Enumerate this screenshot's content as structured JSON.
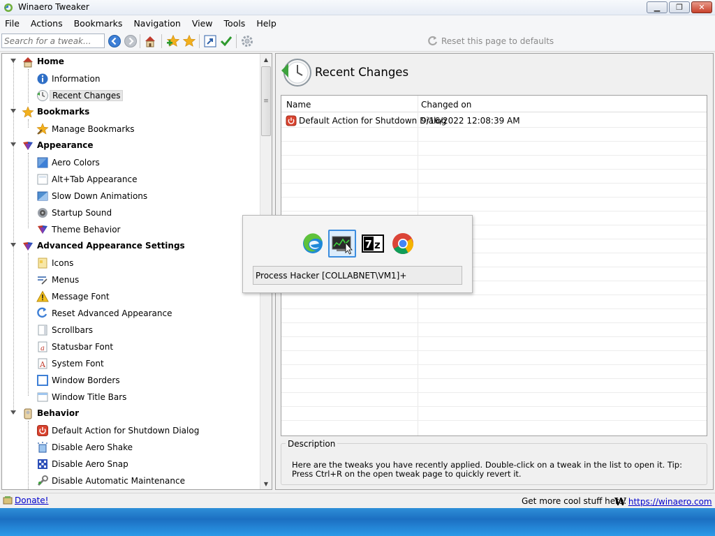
{
  "window": {
    "title": "Winaero Tweaker"
  },
  "menu": [
    "File",
    "Actions",
    "Bookmarks",
    "Navigation",
    "View",
    "Tools",
    "Help"
  ],
  "toolbar": {
    "search_placeholder": "Search for a tweak...",
    "reset_label": "Reset this page to defaults"
  },
  "tree": {
    "home": "Home",
    "information": "Information",
    "recent_changes": "Recent Changes",
    "bookmarks": "Bookmarks",
    "manage_bookmarks": "Manage Bookmarks",
    "appearance": "Appearance",
    "aero_colors": "Aero Colors",
    "alt_tab_appearance": "Alt+Tab Appearance",
    "slow_down_animations": "Slow Down Animations",
    "startup_sound": "Startup Sound",
    "theme_behavior": "Theme Behavior",
    "advanced_appearance": "Advanced Appearance Settings",
    "icons": "Icons",
    "menus": "Menus",
    "message_font": "Message Font",
    "reset_advanced_appearance": "Reset Advanced Appearance",
    "scrollbars": "Scrollbars",
    "statusbar_font": "Statusbar Font",
    "system_font": "System Font",
    "window_borders": "Window Borders",
    "window_title_bars": "Window Title Bars",
    "behavior": "Behavior",
    "default_action_shutdown": "Default Action for Shutdown Dialog",
    "disable_aero_shake": "Disable Aero Shake",
    "disable_aero_snap": "Disable Aero Snap",
    "disable_automatic_maintenance": "Disable Automatic Maintenance"
  },
  "page": {
    "title": "Recent Changes",
    "columns": {
      "name": "Name",
      "changed_on": "Changed on"
    },
    "rows": [
      {
        "name": "Default Action for Shutdown Dialog",
        "changed_on": "9/16/2022 12:08:39 AM"
      }
    ],
    "description_legend": "Description",
    "description_text": "Here are the tweaks you have recently applied. Double-click on a tweak in the list to open it. Tip: Press Ctrl+R on the open tweak page to quickly revert it."
  },
  "statusbar": {
    "donate": "Donate!",
    "more": "Get more cool stuff here:",
    "site_logo": "W",
    "site_url": "https://winaero.com"
  },
  "alttab": {
    "apps": [
      "edge-icon",
      "process-hacker-icon",
      "7zip-icon",
      "chrome-icon"
    ],
    "selected_index": 1,
    "caption": "Process Hacker [COLLABNET\\VM1]+",
    "sevenzip_label": "7z"
  }
}
